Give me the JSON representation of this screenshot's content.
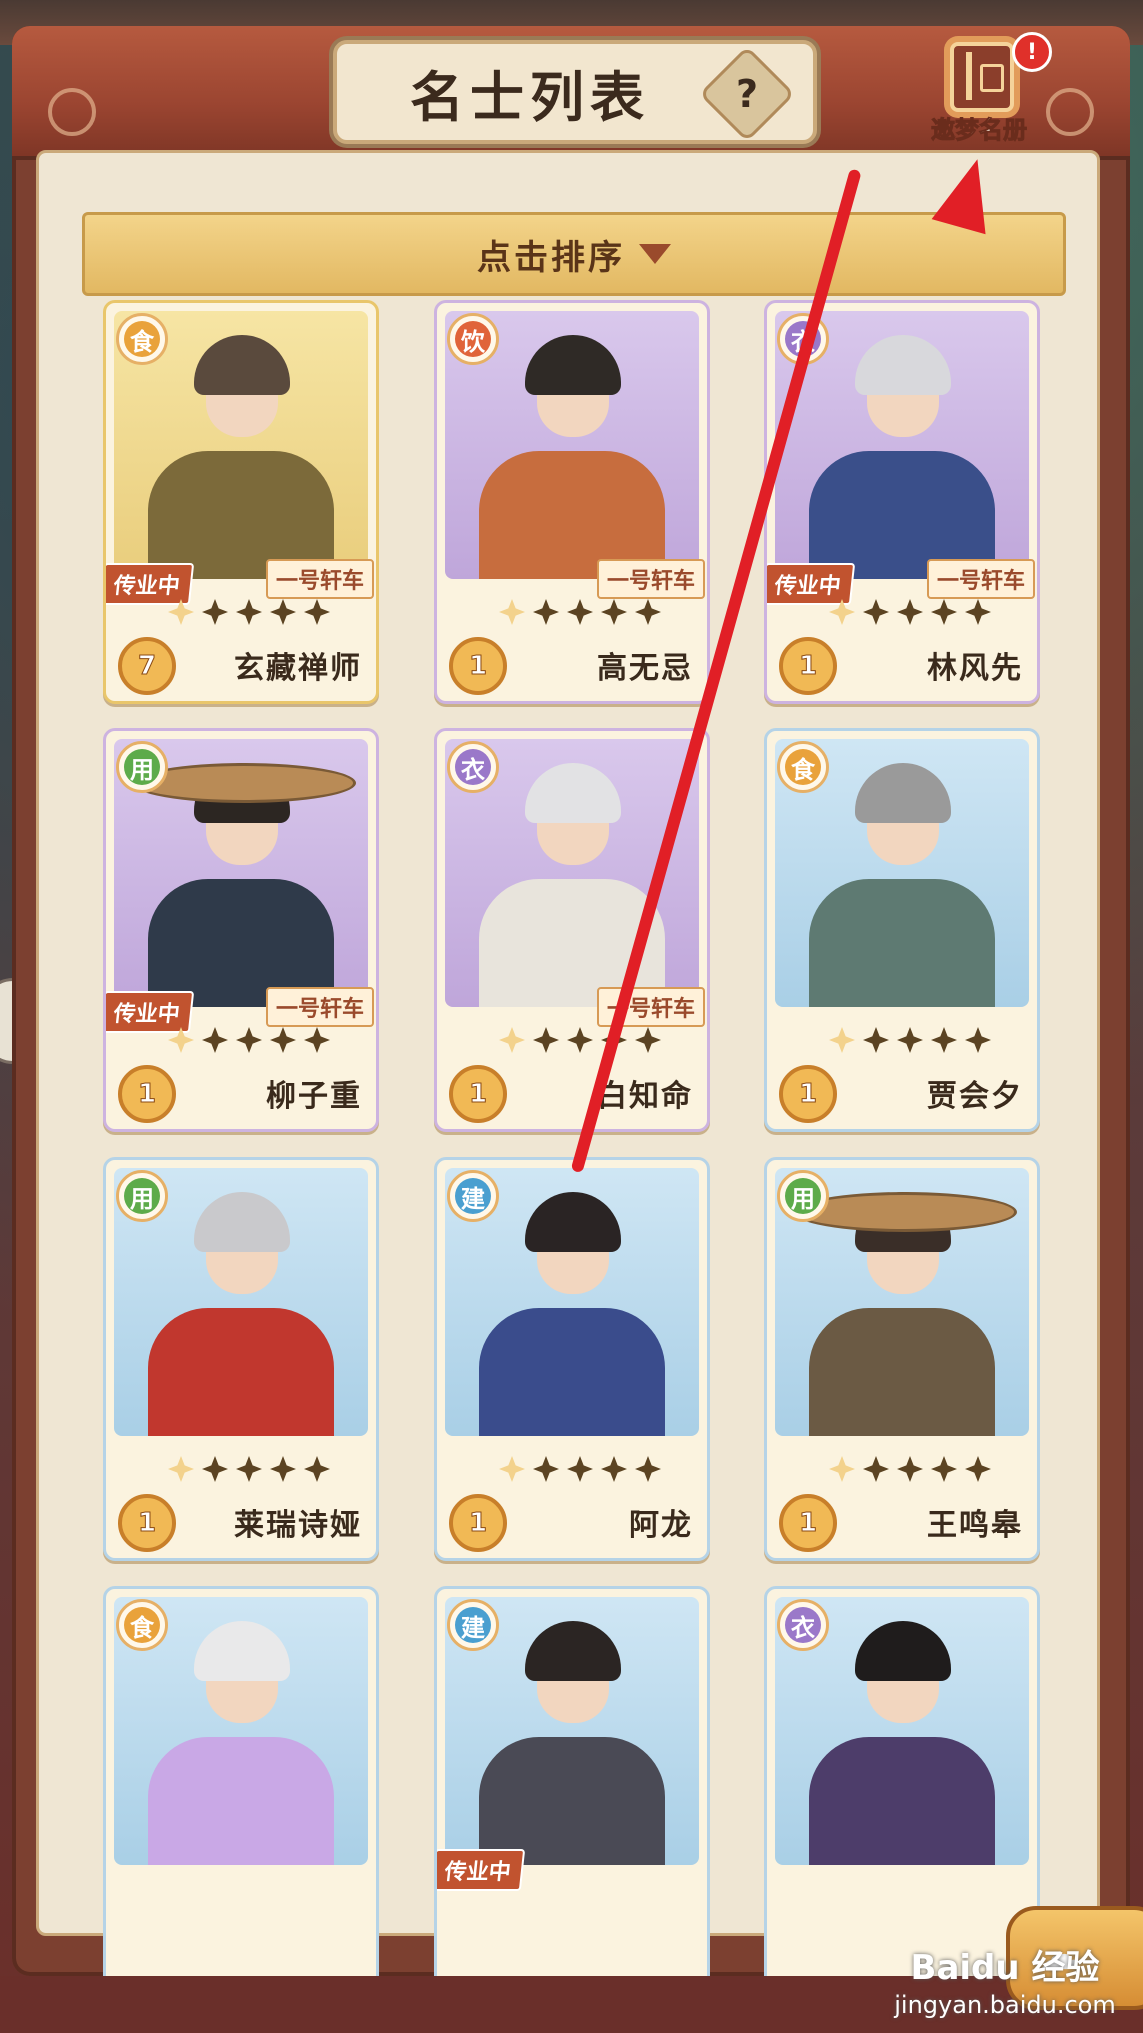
{
  "header": {
    "title": "名士列表",
    "help_icon": "question-mark",
    "roster_button": {
      "label": "邀梦名册",
      "icon": "book-icon",
      "alert": "!"
    }
  },
  "sort": {
    "label": "点击排序",
    "icon": "triangle-down"
  },
  "colors": {
    "header": "#9b4531",
    "panel": "#efe6d3",
    "sort_bar": "#e9c36f",
    "annotation_arrow": "#e11f26"
  },
  "cards": [
    {
      "name": "玄藏禅师",
      "category": "食",
      "level": "7",
      "working": "传业中",
      "cart": "一号轩车",
      "stars_lit": 1,
      "frame": "gold"
    },
    {
      "name": "高无忌",
      "category": "饮",
      "level": "1",
      "working": "",
      "cart": "一号轩车",
      "stars_lit": 1,
      "frame": "purple"
    },
    {
      "name": "林风先",
      "category": "衣",
      "level": "1",
      "working": "传业中",
      "cart": "一号轩车",
      "stars_lit": 1,
      "frame": "purple"
    },
    {
      "name": "柳子重",
      "category": "用",
      "level": "1",
      "working": "传业中",
      "cart": "一号轩车",
      "stars_lit": 1,
      "frame": "purple"
    },
    {
      "name": "白知命",
      "category": "衣",
      "level": "1",
      "working": "",
      "cart": "一号轩车",
      "stars_lit": 1,
      "frame": "purple"
    },
    {
      "name": "贾会夕",
      "category": "食",
      "level": "1",
      "working": "",
      "cart": "",
      "stars_lit": 1,
      "frame": "blue"
    },
    {
      "name": "莱瑞诗娅",
      "category": "用",
      "level": "1",
      "working": "",
      "cart": "",
      "stars_lit": 1,
      "frame": "blue"
    },
    {
      "name": "阿龙",
      "category": "建",
      "level": "1",
      "working": "",
      "cart": "",
      "stars_lit": 1,
      "frame": "blue"
    },
    {
      "name": "王鸣皋",
      "category": "用",
      "level": "1",
      "working": "",
      "cart": "",
      "stars_lit": 1,
      "frame": "blue"
    },
    {
      "name": "",
      "category": "食",
      "level": "",
      "working": "",
      "cart": "",
      "stars_lit": 0,
      "frame": "blue"
    },
    {
      "name": "",
      "category": "建",
      "level": "",
      "working": "传业中",
      "cart": "",
      "stars_lit": 0,
      "frame": "blue"
    },
    {
      "name": "",
      "category": "衣",
      "level": "",
      "working": "",
      "cart": "",
      "stars_lit": 0,
      "frame": "blue"
    }
  ],
  "watermark": {
    "brand": "Baidu 经验",
    "url": "jingyan.baidu.com"
  }
}
